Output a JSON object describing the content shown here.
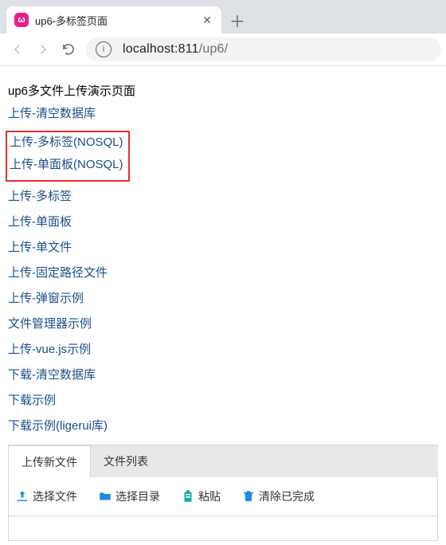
{
  "browser": {
    "tab_title": "up6-多标签页面",
    "url_host": "localhost:811",
    "url_path": "/up6/"
  },
  "page": {
    "heading": "up6多文件上传演示页面",
    "links_before": [
      "上传-清空数据库"
    ],
    "links_highlighted": [
      "上传-多标签(NOSQL)",
      "上传-单面板(NOSQL)"
    ],
    "links_after": [
      "上传-多标签",
      "上传-单面板",
      "上传-单文件",
      "上传-固定路径文件",
      "上传-弹窗示例",
      "文件管理器示例",
      "上传-vue.js示例",
      "下载-清空数据库",
      "下载示例",
      "下载示例(ligerui库)"
    ],
    "tabs": {
      "upload_new": "上传新文件",
      "file_list": "文件列表"
    },
    "actions": {
      "select_file": "选择文件",
      "select_dir": "选择目录",
      "paste": "粘贴",
      "clear_done": "清除已完成"
    }
  }
}
